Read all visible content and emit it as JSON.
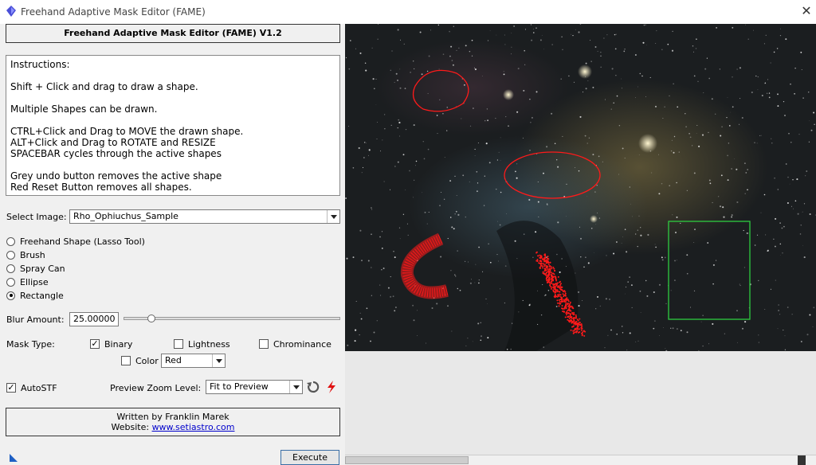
{
  "window": {
    "title": "Freehand Adaptive Mask Editor (FAME)"
  },
  "header": {
    "title": "Freehand Adaptive Mask Editor (FAME) V1.2"
  },
  "instructions": {
    "lines": [
      "Instructions:",
      "",
      "Shift + Click and drag to draw a shape.",
      "",
      "Multiple Shapes can be drawn.",
      "",
      "CTRL+Click and Drag to MOVE the drawn shape.",
      "ALT+Click and Drag to ROTATE and RESIZE",
      "SPACEBAR cycles through the active shapes",
      "",
      "Grey undo button removes the active shape",
      "Red Reset Button removes all shapes."
    ]
  },
  "select_image": {
    "label": "Select Image:",
    "value": "Rho_Ophiuchus_Sample"
  },
  "tools": [
    {
      "label": "Freehand Shape (Lasso Tool)",
      "selected": false
    },
    {
      "label": "Brush",
      "selected": false
    },
    {
      "label": "Spray Can",
      "selected": false
    },
    {
      "label": "Ellipse",
      "selected": false
    },
    {
      "label": "Rectangle",
      "selected": true
    }
  ],
  "blur": {
    "label": "Blur Amount:",
    "value": "25.00000",
    "slider_fraction": 0.13
  },
  "mask_type": {
    "label": "Mask Type:",
    "binary": {
      "label": "Binary",
      "checked": true
    },
    "lightness": {
      "label": "Lightness",
      "checked": false
    },
    "chrominance": {
      "label": "Chrominance",
      "checked": false
    },
    "color": {
      "label": "Color",
      "checked": false,
      "value": "Red"
    }
  },
  "autostf": {
    "label": "AutoSTF",
    "checked": true
  },
  "zoom": {
    "label": "Preview Zoom Level:",
    "value": "Fit to Preview"
  },
  "footer": {
    "author": "Written by Franklin Marek",
    "website_label": "Website:",
    "website_link": "www.setiastro.com"
  },
  "execute": {
    "label": "Execute"
  },
  "icons": {
    "close": "close-icon",
    "undo": "undo-icon",
    "reset": "reset-lightning-icon",
    "app": "app-icon"
  },
  "colors": {
    "mask_red": "#ff1a1a",
    "active_shape": "#2ecc40",
    "link": "#0000cc"
  }
}
